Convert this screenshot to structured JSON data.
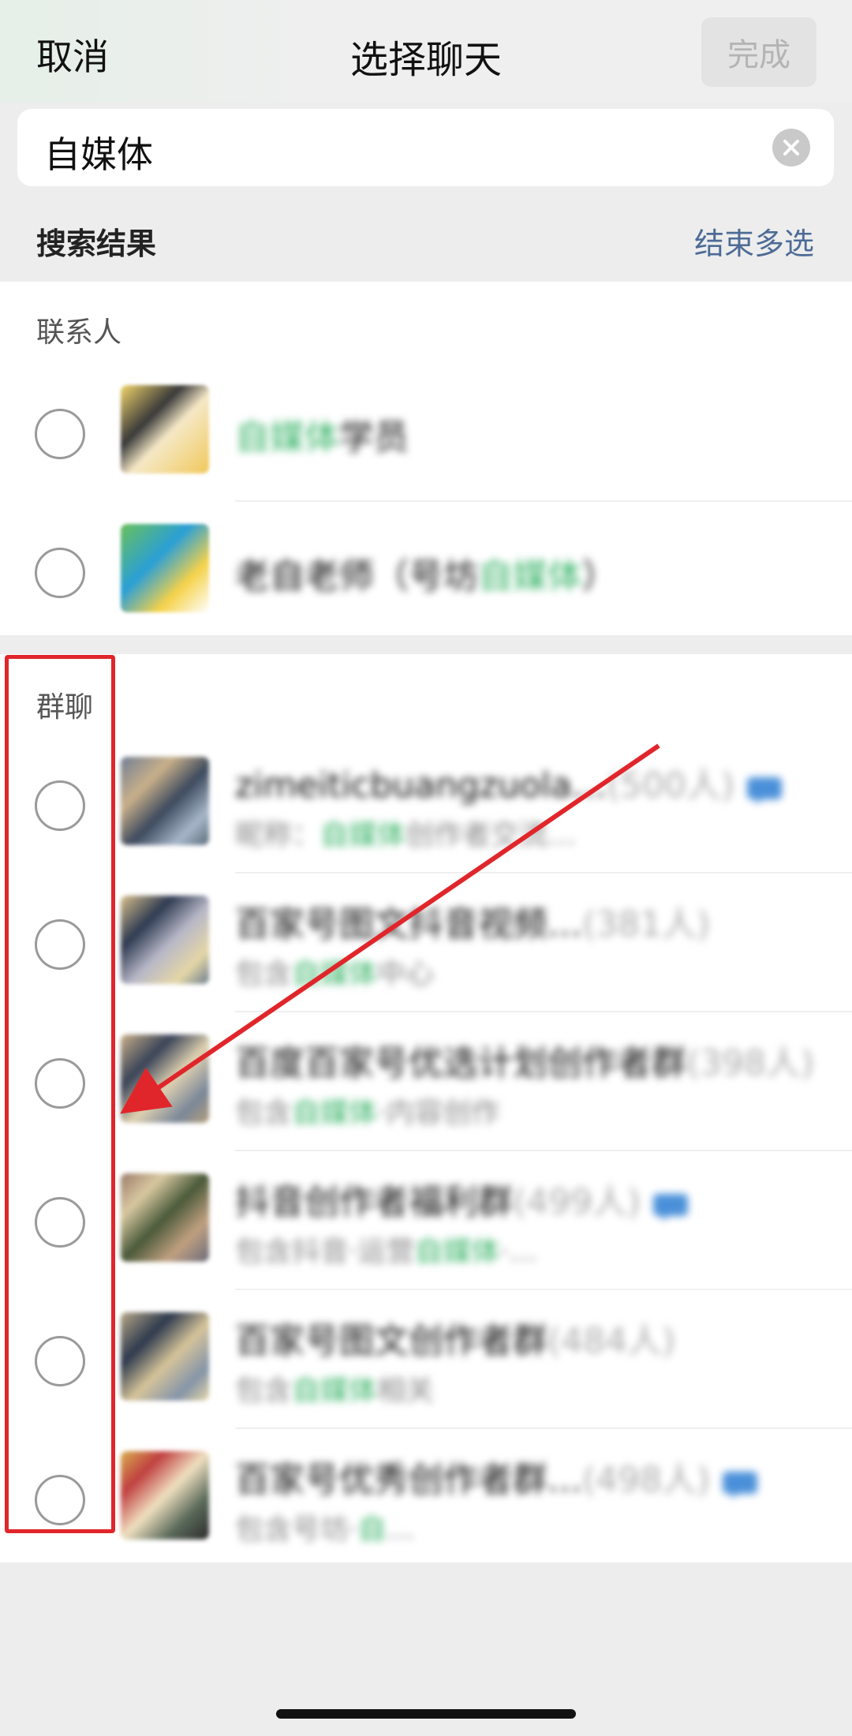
{
  "header": {
    "cancel_label": "取消",
    "title": "选择聊天",
    "done_label": "完成"
  },
  "search": {
    "query": "自媒体"
  },
  "results": {
    "header": "搜索结果",
    "end_multiselect_label": "结束多选"
  },
  "contacts": {
    "section_label": "联系人",
    "items": [
      {
        "name_hl": "自媒体",
        "name_rest": "学员"
      },
      {
        "name_prefix": "老自老师（号坊",
        "name_hl": "自媒体",
        "name_suffix": "）"
      }
    ]
  },
  "groups": {
    "section_label": "群聊",
    "items": [
      {
        "name": "zimeiticbuangzuola…",
        "count": "(500人)",
        "sub_prefix": "昵称：",
        "sub_hl": "自媒体",
        "sub_rest": "创作者交流…"
      },
      {
        "name": "百家号图文抖音视频…",
        "count": "(381人)",
        "sub_prefix": "包含",
        "sub_hl": "自媒体",
        "sub_rest": "中心"
      },
      {
        "name": "百度百家号优选计划创作者群",
        "count": "(398人)",
        "sub_prefix": "包含",
        "sub_hl": "自媒体",
        "sub_rest": "·内容创作"
      },
      {
        "name": "抖音创作者福利群",
        "count": "(499人)",
        "sub_prefix": "包含抖音·运营",
        "sub_hl": "自媒体",
        "sub_rest": "·…"
      },
      {
        "name": "百家号图文创作者群",
        "count": "(484人)",
        "sub_prefix": "包含",
        "sub_hl": "自媒体",
        "sub_rest": "相关"
      },
      {
        "name": "百家号优秀创作者群…",
        "count": "(498人)",
        "sub_prefix": "包含号坊·",
        "sub_hl": "自",
        "sub_rest": "…"
      }
    ]
  },
  "colors": {
    "highlight": "#2fb061",
    "link": "#4c6b96",
    "annotation": "#e0262b"
  }
}
